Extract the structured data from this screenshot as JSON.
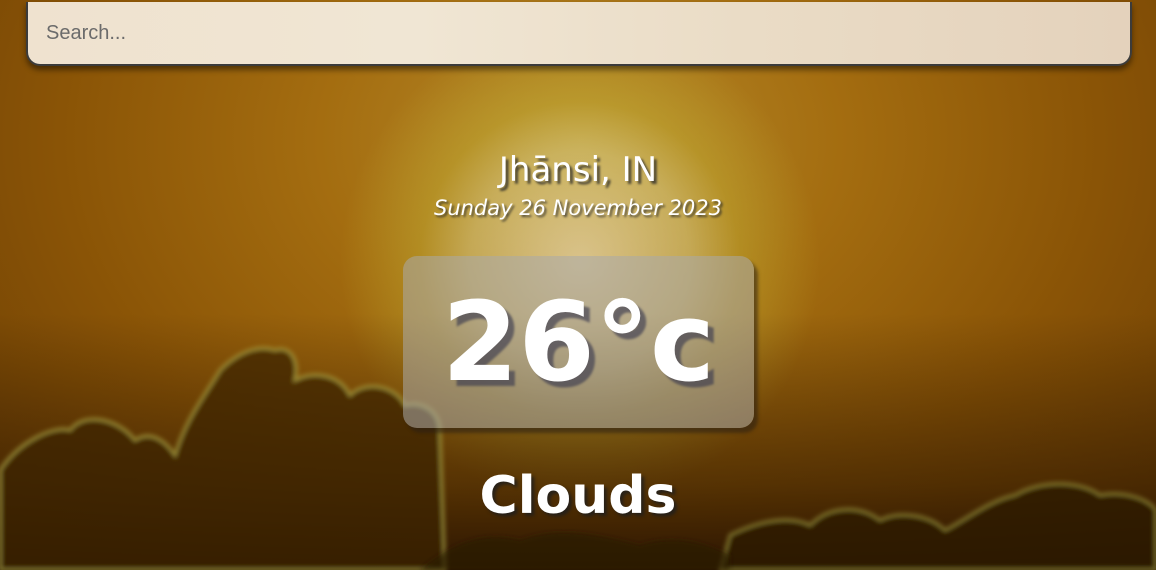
{
  "search": {
    "placeholder": "Search...",
    "value": ""
  },
  "location": {
    "city": "Jhānsi, IN"
  },
  "date": {
    "text": "Sunday 26 November 2023"
  },
  "current": {
    "temperature": "26°c",
    "condition": "Clouds"
  },
  "colors": {
    "sky_top": "#a46d10",
    "sky_bottom": "#3a1f02",
    "search_background": "#efe2cf",
    "text": "#ffffff"
  },
  "icons": {
    "background": "sunset-clouds-background"
  }
}
